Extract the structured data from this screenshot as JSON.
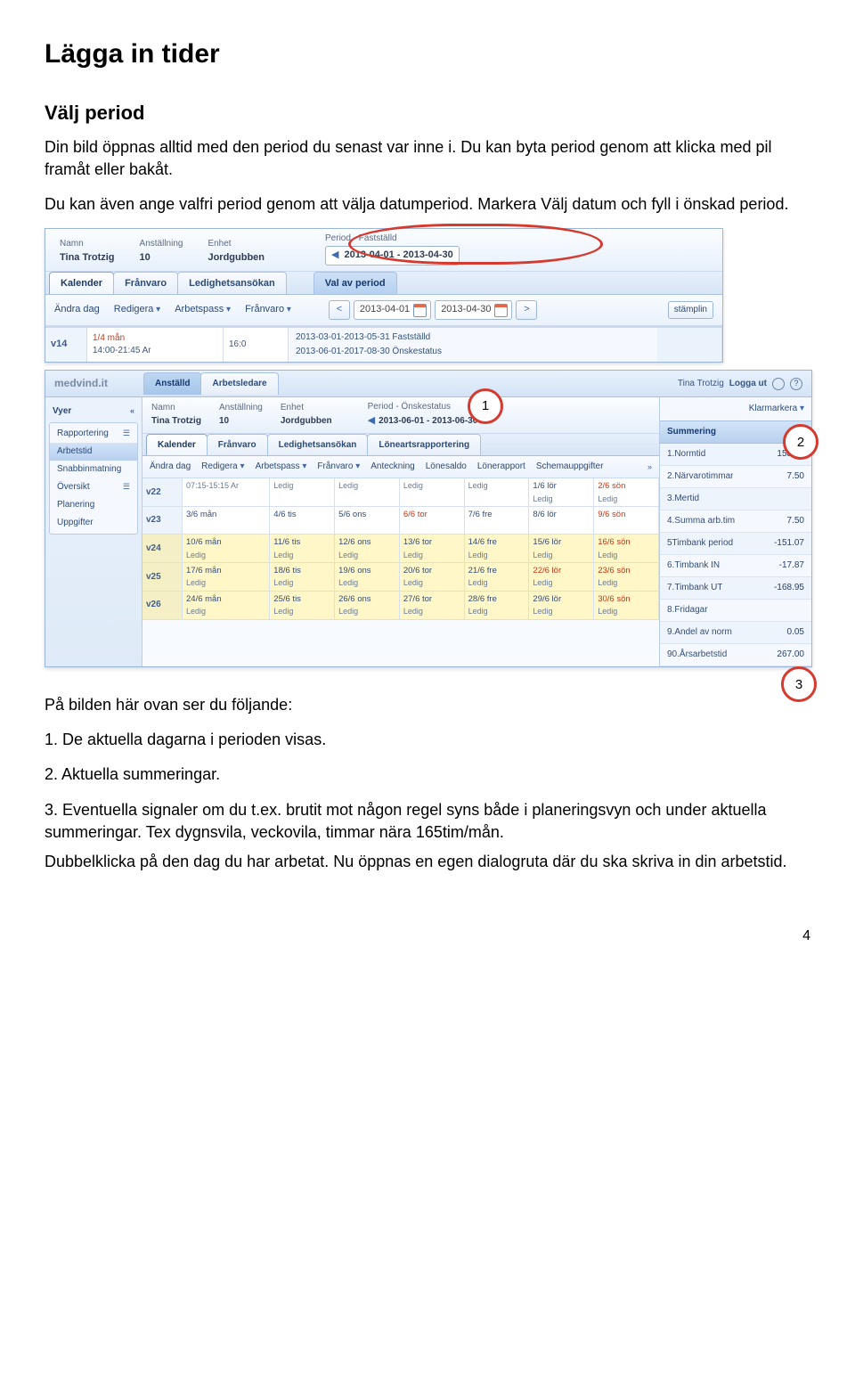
{
  "doc": {
    "title": "Lägga in tider",
    "section": "Välj period",
    "p1": "Din bild öppnas alltid med den period du senast var inne i. Du kan byta period genom att klicka med pil framåt eller bakåt.",
    "p2": "Du kan även ange valfri period genom att välja datumperiod. Markera Välj datum och fyll i önskad period.",
    "intro_list": "På bilden här ovan ser du följande:",
    "li1": "1. De aktuella dagarna i perioden visas.",
    "li2": "2. Aktuella summeringar.",
    "li3": "3. Eventuella signaler om du t.ex. brutit mot någon regel syns både i planeringsvyn och under aktuella summeringar. Tex dygnsvila, veckovila, timmar nära 165tim/mån.",
    "closing": "Dubbelklicka på den dag du har arbetat. Nu öppnas en egen dialogruta där du ska skriva in din arbetstid.",
    "page": "4"
  },
  "s1": {
    "labels": {
      "name": "Namn",
      "employment": "Anställning",
      "unit": "Enhet",
      "period": "Period - Fastställd"
    },
    "vals": {
      "name": "Tina Trotzig",
      "employment": "10",
      "unit": "Jordgubben",
      "period": "2013-04-01 - 2013-04-30"
    },
    "tabs": {
      "kalender": "Kalender",
      "franvaro": "Frånvaro",
      "ledighet": "Ledighetsansökan",
      "valperiod": "Val av period"
    },
    "tools": {
      "andra": "Ändra dag",
      "redigera": "Redigera",
      "arbetspass": "Arbetspass",
      "franvaro": "Frånvaro"
    },
    "date_from": "2013-04-01",
    "date_to": "2013-04-30",
    "week": "v14",
    "top_note": "1/4 mån",
    "time": "14:00-21:45 Ar",
    "endtime": "16:0",
    "hist1": "2013-03-01-2013-05-31 Fastställd",
    "hist2": "2013-06-01-2017-08-30 Önskestatus",
    "stamp": "stämplin"
  },
  "s2": {
    "brand": "medvind",
    "brand_sfx": ".it",
    "roles": {
      "anstalld": "Anställd",
      "arbetsledare": "Arbetsledare"
    },
    "user": "Tina Trotzig",
    "logout": "Logga ut",
    "side": {
      "vyer": "Vyer",
      "grp_rapp": "Rapportering",
      "arbetstid": "Arbetstid",
      "snabb": "Snabbinmatning",
      "oversikt": "Översikt",
      "planering": "Planering",
      "uppgifter": "Uppgifter"
    },
    "hdr": {
      "labels": {
        "name": "Namn",
        "employment": "Anställning",
        "unit": "Enhet",
        "period": "Period - Önskestatus"
      },
      "vals": {
        "name": "Tina Trotzig",
        "employment": "10",
        "unit": "Jordgubben",
        "period": "2013-06-01 - 2013-06-30"
      }
    },
    "tabs": {
      "kalender": "Kalender",
      "franvaro": "Frånvaro",
      "ledighet": "Ledighetsansökan",
      "loneart": "Löneartsrapportering"
    },
    "tools": {
      "andra": "Ändra dag",
      "redigera": "Redigera",
      "arbetspass": "Arbetspass",
      "franvaro": "Frånvaro",
      "anteckning": "Anteckning",
      "lonesaldo": "Lönesaldo",
      "lonerapport": "Lönerapport",
      "schema": "Schemauppgifter"
    },
    "right": {
      "klar": "Klarmarkera",
      "summering": "Summering",
      "rows": [
        {
          "l": "1.Normtid",
          "v": "158.57"
        },
        {
          "l": "2.Närvarotimmar",
          "v": "7.50"
        },
        {
          "l": "3.Mertid",
          "v": ""
        },
        {
          "l": "4.Summa arb.tim",
          "v": "7.50"
        },
        {
          "l": "5Timbank period",
          "v": "-151.07"
        },
        {
          "l": "6.Timbank IN",
          "v": "-17.87"
        },
        {
          "l": "7.Timbank UT",
          "v": "-168.95"
        },
        {
          "l": "8.Fridagar",
          "v": ""
        },
        {
          "l": "9.Andel av norm",
          "v": "0.05"
        },
        {
          "l": "90.Årsarbetstid",
          "v": "267.00"
        }
      ]
    },
    "weeks": [
      {
        "wk": "v22",
        "days": [
          {
            "d": "",
            "s": "07:15-15:15 Ar"
          },
          {
            "d": "",
            "s": "Ledig"
          },
          {
            "d": "",
            "s": "Ledig"
          },
          {
            "d": "",
            "s": "Ledig"
          },
          {
            "d": "",
            "s": "Ledig"
          },
          {
            "d": "1/6 lör",
            "s": "Ledig",
            "red": false
          },
          {
            "d": "2/6 sön",
            "s": "Ledig",
            "red": true
          }
        ],
        "yellow": false
      },
      {
        "wk": "v23",
        "days": [
          {
            "d": "3/6 mån",
            "s": ""
          },
          {
            "d": "4/6 tis",
            "s": ""
          },
          {
            "d": "5/6 ons",
            "s": ""
          },
          {
            "d": "6/6 tor",
            "s": "",
            "red": true
          },
          {
            "d": "7/6 fre",
            "s": ""
          },
          {
            "d": "8/6 lör",
            "s": ""
          },
          {
            "d": "9/6 sön",
            "s": "",
            "red": true
          }
        ],
        "yellow": false
      },
      {
        "wk": "v24",
        "days": [
          {
            "d": "10/6 mån",
            "s": "Ledig"
          },
          {
            "d": "11/6 tis",
            "s": "Ledig"
          },
          {
            "d": "12/6 ons",
            "s": "Ledig"
          },
          {
            "d": "13/6 tor",
            "s": "Ledig"
          },
          {
            "d": "14/6 fre",
            "s": "Ledig"
          },
          {
            "d": "15/6 lör",
            "s": "Ledig"
          },
          {
            "d": "16/6 sön",
            "s": "Ledig",
            "red": true
          }
        ],
        "yellow": true
      },
      {
        "wk": "v25",
        "days": [
          {
            "d": "17/6 mån",
            "s": "Ledig"
          },
          {
            "d": "18/6 tis",
            "s": "Ledig"
          },
          {
            "d": "19/6 ons",
            "s": "Ledig"
          },
          {
            "d": "20/6 tor",
            "s": "Ledig"
          },
          {
            "d": "21/6 fre",
            "s": "Ledig",
            "red": false
          },
          {
            "d": "22/6 lör",
            "s": "Ledig",
            "red": true
          },
          {
            "d": "23/6 sön",
            "s": "Ledig",
            "red": true
          }
        ],
        "yellow": true
      },
      {
        "wk": "v26",
        "days": [
          {
            "d": "24/6 mån",
            "s": "Ledig"
          },
          {
            "d": "25/6 tis",
            "s": "Ledig"
          },
          {
            "d": "26/6 ons",
            "s": "Ledig"
          },
          {
            "d": "27/6 tor",
            "s": "Ledig"
          },
          {
            "d": "28/6 fre",
            "s": "Ledig"
          },
          {
            "d": "29/6 lör",
            "s": "Ledig"
          },
          {
            "d": "30/6 sön",
            "s": "Ledig",
            "red": true
          }
        ],
        "yellow": true
      }
    ],
    "circles": {
      "c1": "1",
      "c2": "2",
      "c3": "3"
    }
  }
}
